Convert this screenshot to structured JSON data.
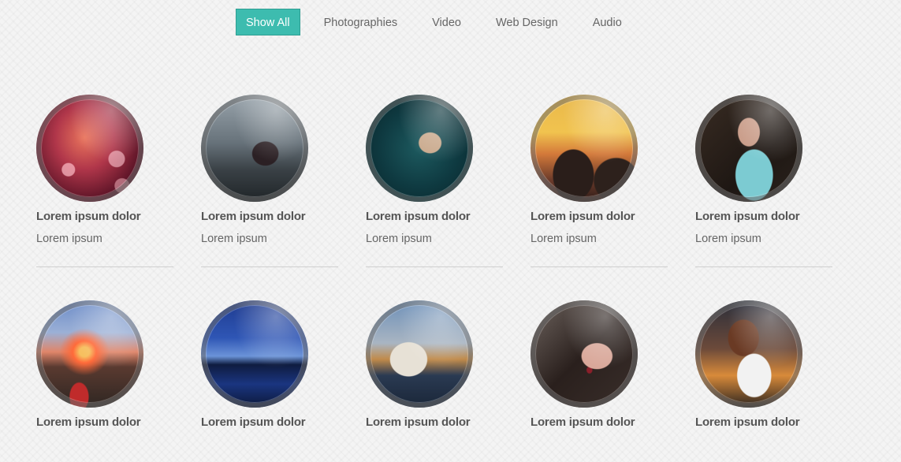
{
  "filters": {
    "show_all": "Show All",
    "photographies": "Photographies",
    "video": "Video",
    "web_design": "Web Design",
    "audio": "Audio"
  },
  "colors": {
    "accent": "#3dbcaf",
    "text": "#555555",
    "divider": "#cfcfcf"
  },
  "row1": [
    {
      "title": "Lorem ipsum dolor",
      "subtitle": "Lorem ipsum",
      "image": "woman-bokeh-photo"
    },
    {
      "title": "Lorem ipsum dolor",
      "subtitle": "Lorem ipsum",
      "image": "woman-road-photo"
    },
    {
      "title": "Lorem ipsum dolor",
      "subtitle": "Lorem ipsum",
      "image": "woman-teal-night-photo"
    },
    {
      "title": "Lorem ipsum dolor",
      "subtitle": "Lorem ipsum",
      "image": "sunset-rocks-photo"
    },
    {
      "title": "Lorem ipsum dolor",
      "subtitle": "Lorem ipsum",
      "image": "woman-teal-shirt-photo"
    }
  ],
  "row2": [
    {
      "title": "Lorem ipsum dolor",
      "image": "motorcycle-sunset-photo"
    },
    {
      "title": "Lorem ipsum dolor",
      "image": "city-lights-blue-photo"
    },
    {
      "title": "Lorem ipsum dolor",
      "image": "boat-harbor-photo"
    },
    {
      "title": "Lorem ipsum dolor",
      "image": "woman-portrait-photo"
    },
    {
      "title": "Lorem ipsum dolor",
      "image": "woman-white-coat-photo"
    }
  ]
}
